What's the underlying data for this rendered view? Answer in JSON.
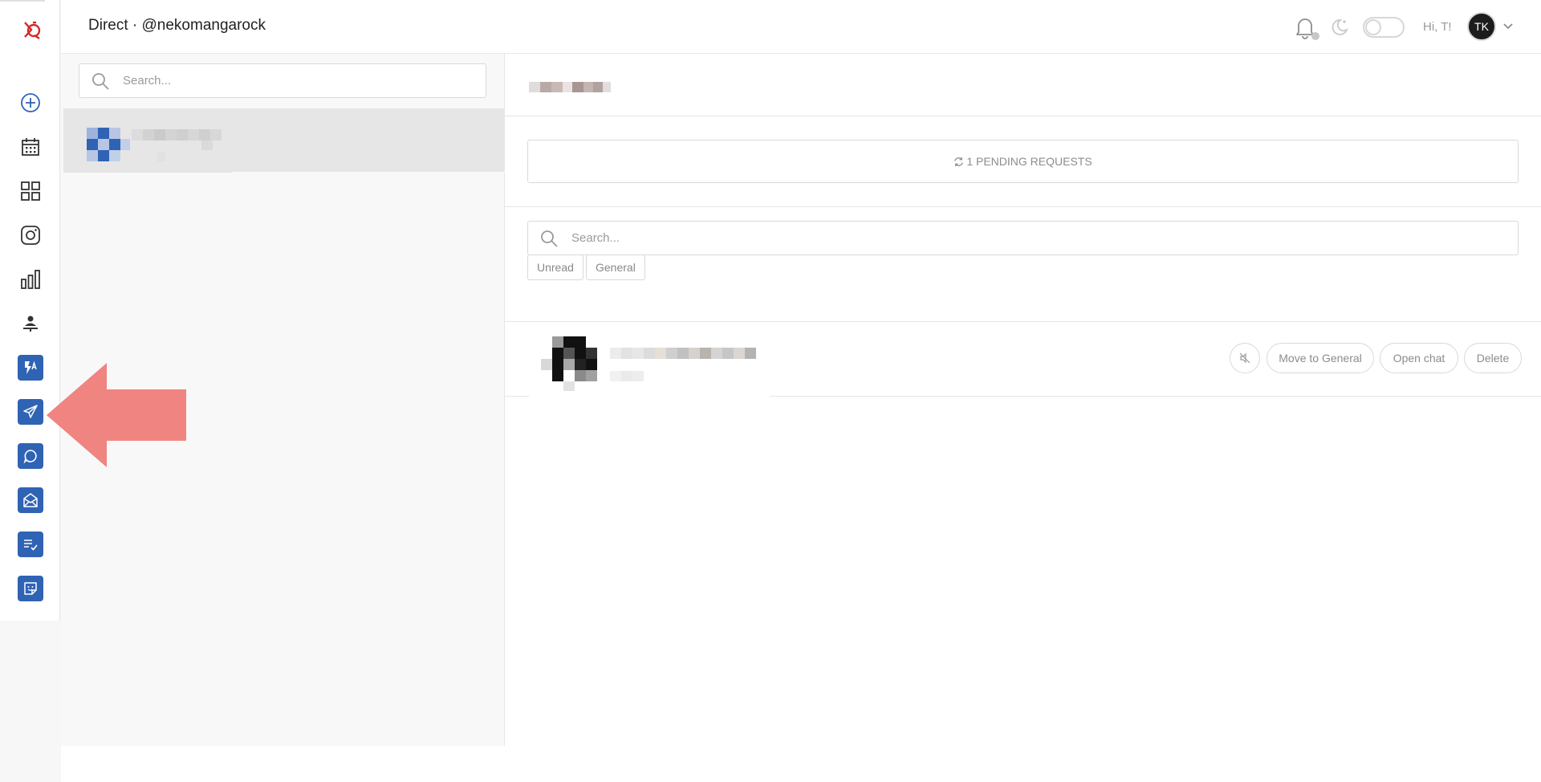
{
  "header": {
    "title": "Direct · @nekomangarock",
    "greeting": "Hi, T!",
    "avatar_initials": "TK"
  },
  "sidebar": {
    "icons": [
      "add-circle-icon",
      "calendar-icon",
      "grid-icon",
      "instagram-icon",
      "bar-chart-icon",
      "person-podium-icon",
      "flash-text-icon",
      "send-icon",
      "chat-bubble-icon",
      "mail-open-icon",
      "checklist-icon",
      "sticker-icon"
    ],
    "active_item": "send-icon"
  },
  "list": {
    "search_placeholder": "Search..."
  },
  "requests": {
    "pending_label": "1 PENDING REQUESTS",
    "search_placeholder": "Search...",
    "tabs": [
      "Unread",
      "General"
    ],
    "actions": {
      "move": "Move to General",
      "open": "Open chat",
      "delete": "Delete"
    }
  },
  "colors": {
    "accent": "#2f63b4",
    "logo": "#d62828",
    "arrow": "#ef8481"
  }
}
